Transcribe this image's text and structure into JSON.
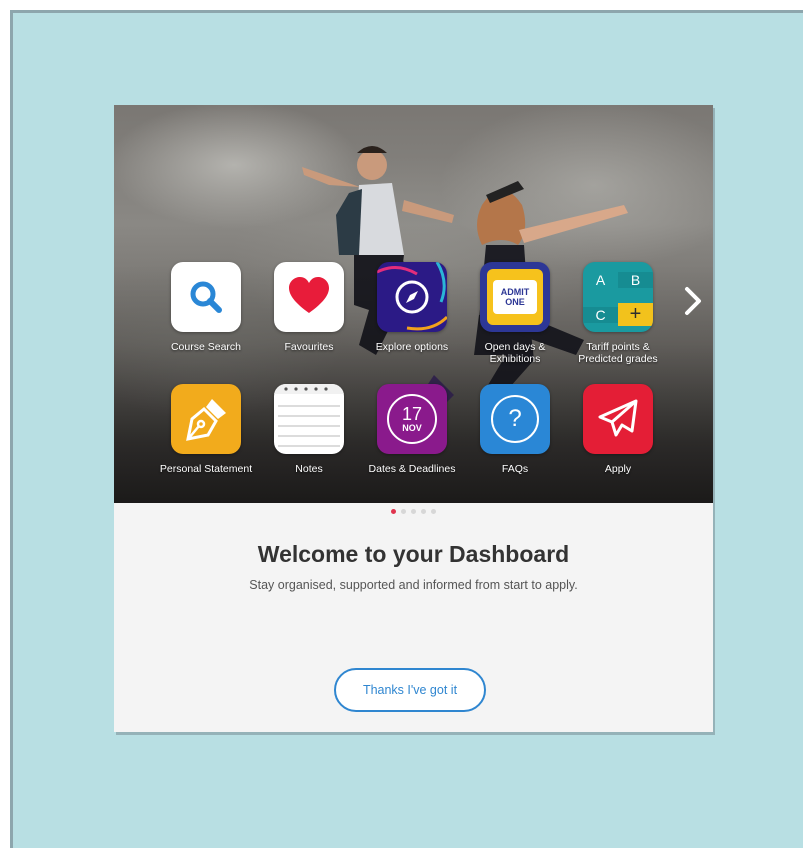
{
  "apps": [
    {
      "label": "Course Search",
      "icon": "search-icon",
      "color": "#ffffff"
    },
    {
      "label": "Favourites",
      "icon": "heart-icon",
      "color": "#ffffff"
    },
    {
      "label": "Explore options",
      "icon": "compass-icon",
      "color": "#2b1a86"
    },
    {
      "label": "Open days & Exhibitions",
      "icon": "ticket-icon",
      "color": "#2d3796",
      "ticket_text": "ADMIT ONE"
    },
    {
      "label": "Tariff points & Predicted grades",
      "icon": "grades-icon",
      "color": "#1a9aa0",
      "grid": [
        "A",
        "B",
        "C",
        "+"
      ]
    },
    {
      "label": "Personal Statement",
      "icon": "pen-icon",
      "color": "#f2ab1c"
    },
    {
      "label": "Notes",
      "icon": "notepad-icon",
      "color": "#ffffff"
    },
    {
      "label": "Dates & Deadlines",
      "icon": "calendar-icon",
      "color": "#8a1a8c",
      "day": "17",
      "month": "NOV"
    },
    {
      "label": "FAQs",
      "icon": "question-icon",
      "color": "#2a87d6"
    },
    {
      "label": "Apply",
      "icon": "paper-plane-icon",
      "color": "#e41e36"
    }
  ],
  "carousel": {
    "page_count": 5,
    "active_index": 0
  },
  "welcome": {
    "title": "Welcome to your Dashboard",
    "subtitle": "Stay organised, supported and informed from start to apply."
  },
  "actions": {
    "confirm_label": "Thanks I've got it"
  },
  "colors": {
    "background": "#b8dfe3",
    "accent": "#2f86d0",
    "dot_active": "#e0344e"
  }
}
